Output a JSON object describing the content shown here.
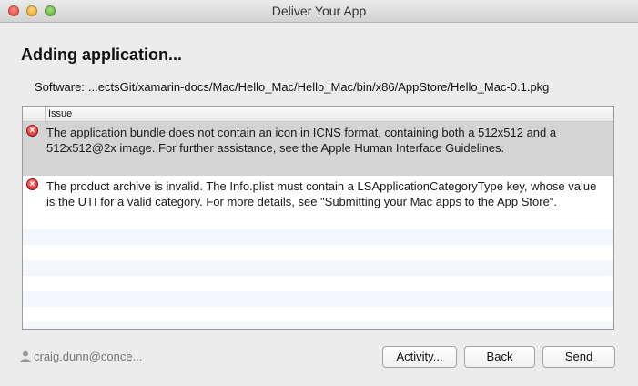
{
  "window": {
    "title": "Deliver Your App"
  },
  "heading": "Adding application...",
  "software": {
    "label": "Software:",
    "path": "...ectsGit/xamarin-docs/Mac/Hello_Mac/Hello_Mac/bin/x86/AppStore/Hello_Mac-0.1.pkg"
  },
  "issues": {
    "column_header": "Issue",
    "rows": [
      {
        "text": "The application bundle does not contain an icon in ICNS format, containing both a 512x512 and a 512x512@2x image. For further assistance, see the Apple Human Interface Guidelines.",
        "icon": "error-icon",
        "selected": true
      },
      {
        "text": "The product archive is invalid. The Info.plist must contain a LSApplicationCategoryType key, whose value is the UTI for a valid category. For more details, see \"Submitting your Mac apps to the App Store\".",
        "icon": "error-icon",
        "selected": false
      }
    ]
  },
  "footer": {
    "user": "craig.dunn@conce...",
    "buttons": {
      "activity": "Activity...",
      "back": "Back",
      "send": "Send"
    }
  },
  "colors": {
    "error": "#c81818",
    "selected_row": "#d4d4d4"
  }
}
